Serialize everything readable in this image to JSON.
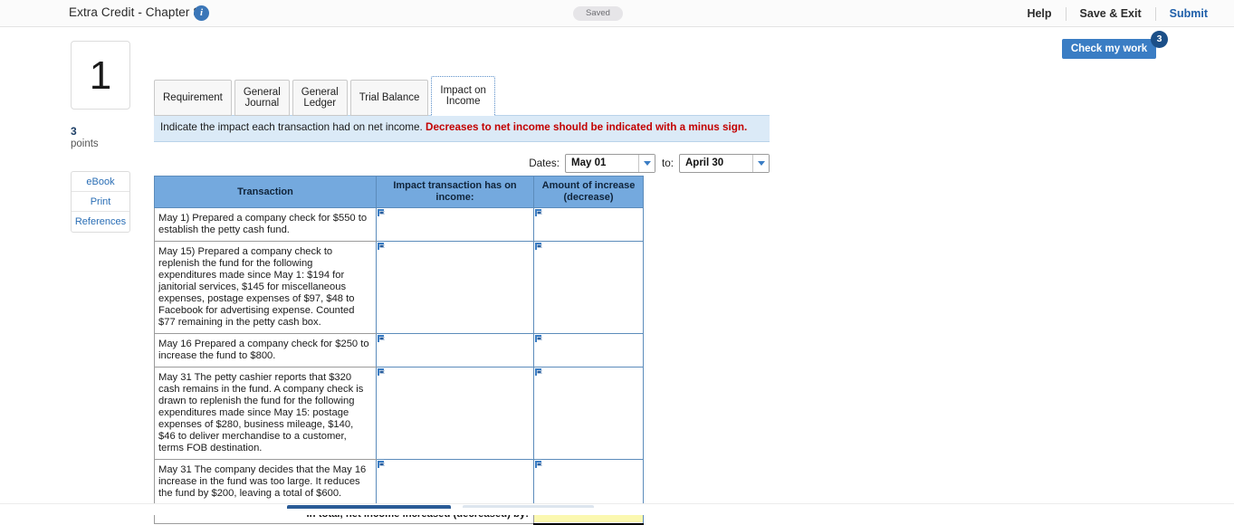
{
  "topbar": {
    "title": "Extra Credit - Chapter 8",
    "info_icon": "info-icon",
    "status_pill": "Saved",
    "help_label": "Help",
    "save_exit_label": "Save & Exit",
    "submit_label": "Submit"
  },
  "check_work": {
    "label": "Check my work",
    "badge_count": "3"
  },
  "rail": {
    "question_number": "1",
    "points_value": "3",
    "points_label": "points",
    "links": [
      {
        "label": "eBook"
      },
      {
        "label": "Print"
      },
      {
        "label": "References"
      }
    ]
  },
  "tabs": [
    {
      "label": "Requirement",
      "active": false
    },
    {
      "label": "General\nJournal",
      "active": false
    },
    {
      "label": "General\nLedger",
      "active": false
    },
    {
      "label": "Trial Balance",
      "active": false
    },
    {
      "label": "Impact on\nIncome",
      "active": true
    }
  ],
  "banner": {
    "text": "Indicate the impact each transaction had on net income. ",
    "warning": "Decreases to net income should be indicated with a minus sign."
  },
  "dates": {
    "label": "Dates:",
    "from_value": "May 01",
    "to_label": "to:",
    "to_value": "April 30",
    "caret_icon": "chevron-down-icon"
  },
  "table": {
    "headers": [
      "Transaction",
      "Impact transaction has on income:",
      "Amount of increase (decrease)"
    ],
    "rows": [
      {
        "transaction": "May 1) Prepared a company check for $550 to establish the petty cash fund.",
        "impact": "",
        "amount": ""
      },
      {
        "transaction": "May 15) Prepared a company check to replenish the fund for the following expenditures made since May 1: $194 for janitorial services, $145 for miscellaneous expenses, postage expenses of $97, $48 to Facebook for advertising expense. Counted $77 remaining in the petty cash box.",
        "impact": "",
        "amount": ""
      },
      {
        "transaction": "May 16 Prepared a company check for $250 to increase the fund to $800.",
        "impact": "",
        "amount": ""
      },
      {
        "transaction": "May 31 The petty cashier reports that $320 cash remains in the fund. A company check is drawn to replenish the fund for the following expenditures made since May 15: postage expenses of $280, business mileage, $140, $46 to deliver merchandise to a customer, terms FOB destination.",
        "impact": "",
        "amount": ""
      },
      {
        "transaction": "May 31 The company decides that the May 16 increase in the fund was too large. It reduces the fund by $200, leaving a total of $600.",
        "impact": "",
        "amount": ""
      }
    ],
    "total_label": "In total, net income increased (decreased) by:",
    "total_value": ""
  },
  "colors": {
    "header_blue": "#74a9de",
    "banner_blue": "#dbeaf7",
    "warning_red": "#c30000",
    "accent_blue": "#3a7dc4",
    "badge_navy": "#1b4f88",
    "total_yellow": "#fbf8b0"
  }
}
